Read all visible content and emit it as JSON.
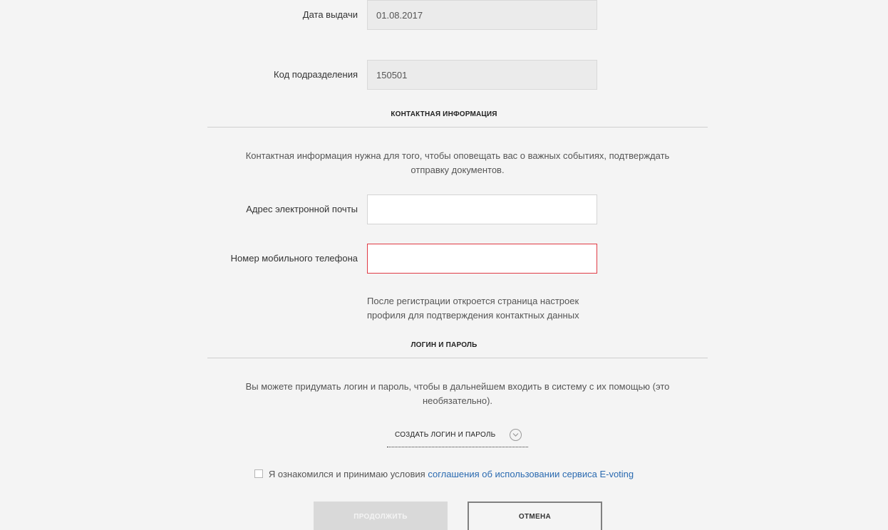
{
  "passport": {
    "issue_date_label": "Дата выдачи",
    "issue_date_value": "01.08.2017",
    "division_code_label": "Код подразделения",
    "division_code_value": "150501"
  },
  "contact_section": {
    "title": "КОНТАКТНАЯ ИНФОРМАЦИЯ",
    "description_line1": "Контактная информация нужна для того, чтобы оповещать вас о важных событиях, подтверждать",
    "description_line2": "отправку документов.",
    "email_label": "Адрес электронной почты",
    "email_value": "",
    "phone_label": "Номер мобильного телефона",
    "phone_value": "",
    "phone_state": "error",
    "hint_line1": "После регистрации откроется страница настроек",
    "hint_line2": "профиля для подтверждения контактных данных"
  },
  "login_section": {
    "title": "ЛОГИН И ПАРОЛЬ",
    "description_line1": "Вы можете придумать логин и пароль, чтобы в дальнейшем входить в систему с их помощью (это",
    "description_line2": "необязательно).",
    "create_link_label": "СОЗДАТЬ ЛОГИН И ПАРОЛЬ",
    "create_link_icon": "chevron-down-icon"
  },
  "agreement": {
    "checked": false,
    "text": "Я ознакомился и принимаю условия ",
    "link_text": "соглашения об использовании сервиса E-voting"
  },
  "buttons": {
    "continue_label": "ПРОДОЛЖИТЬ",
    "continue_enabled": false,
    "cancel_label": "ОТМЕНА"
  },
  "colors": {
    "background": "#f4f4f4",
    "readonly_field": "#ebebeb",
    "error_border": "#e03a44",
    "link": "#2a6ab0",
    "disabled_button": "#d9d9d9"
  }
}
